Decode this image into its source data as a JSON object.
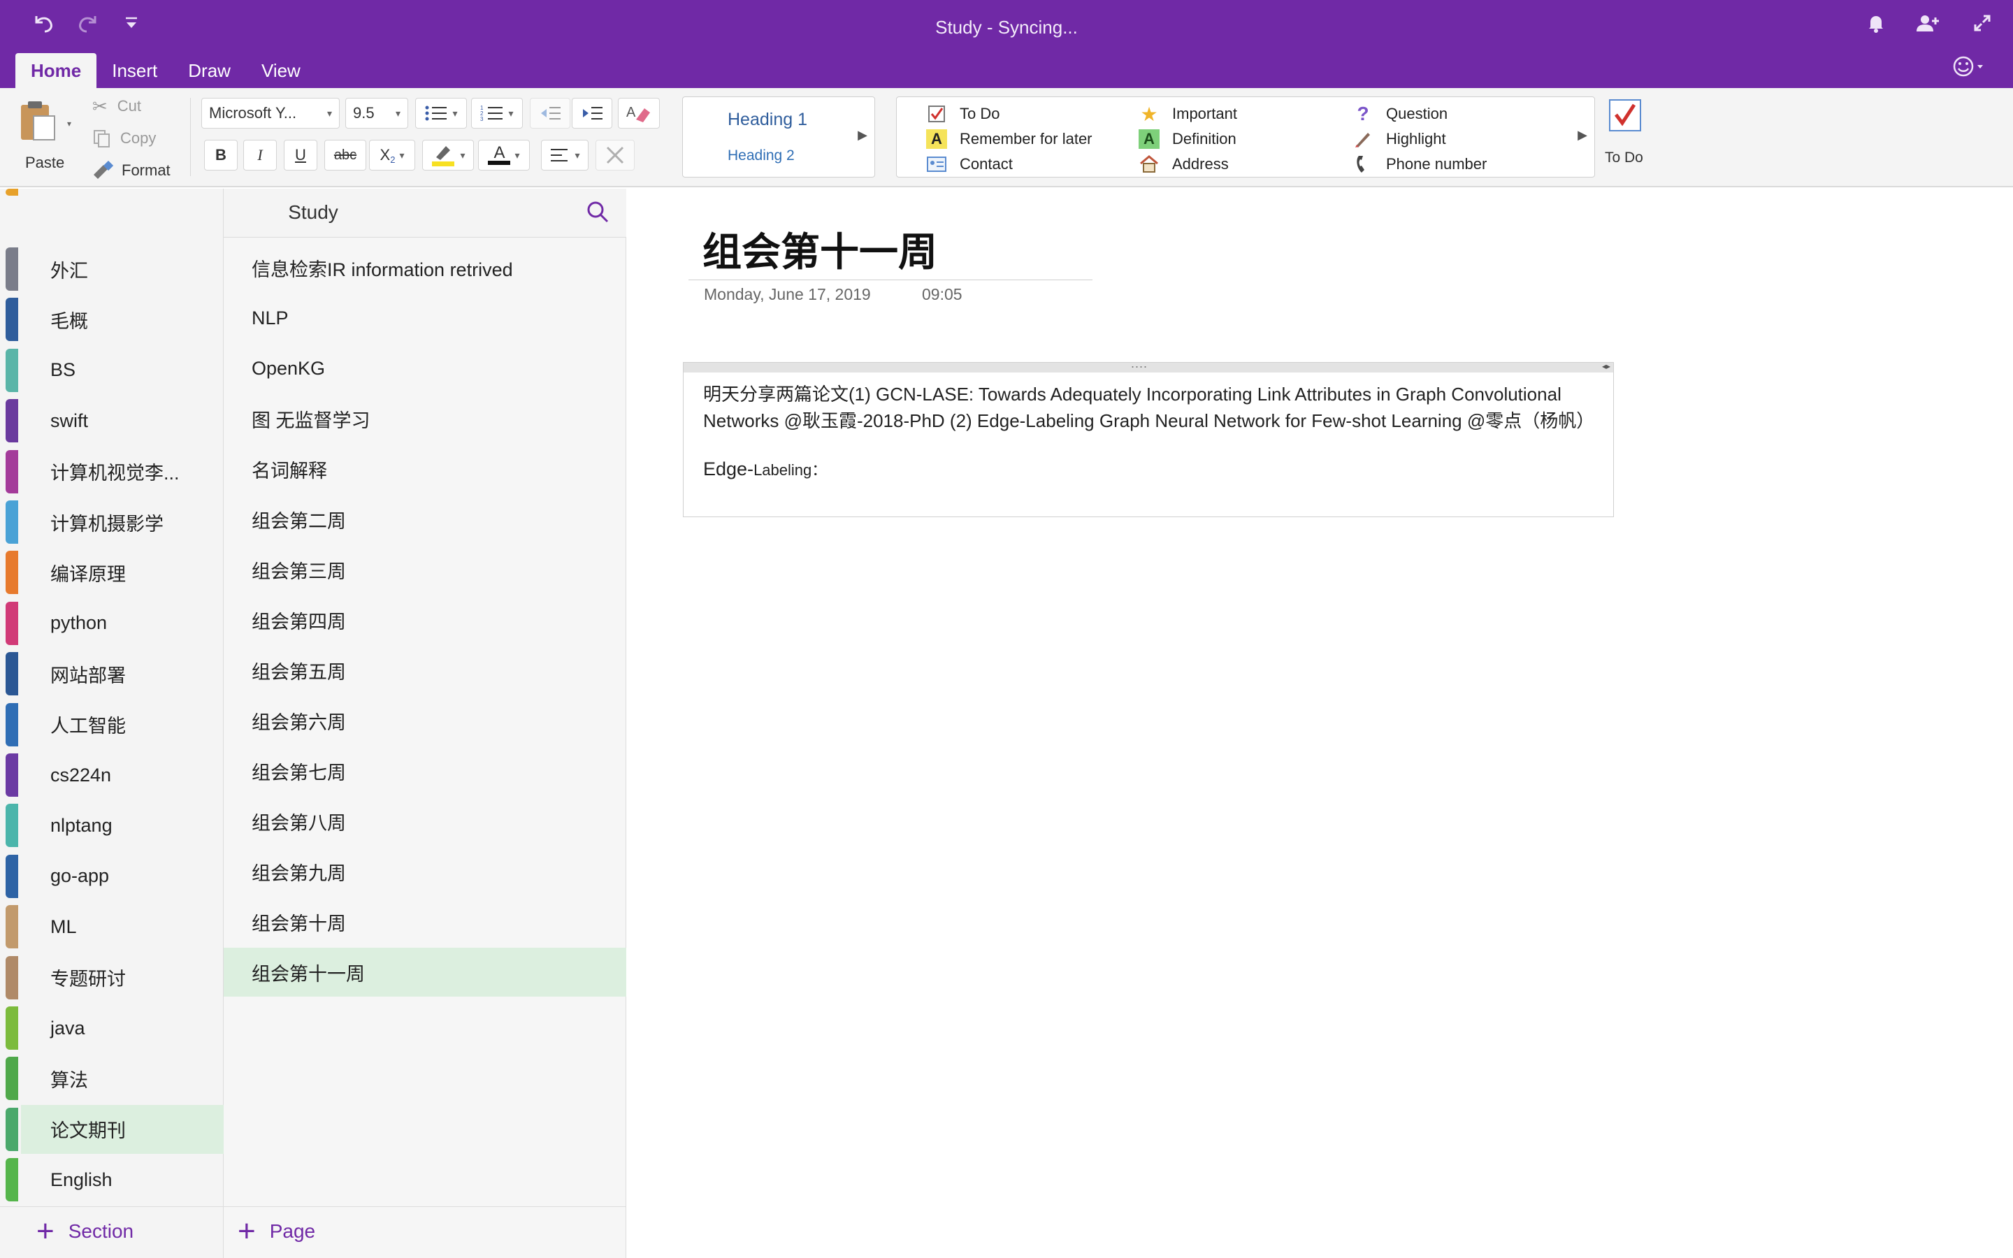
{
  "window": {
    "title": "Study - Syncing...",
    "accent": "#7029a6"
  },
  "quick_access": {
    "undo_icon": "undo-icon",
    "redo_icon": "redo-icon",
    "customize_icon": "chevron-down-icon"
  },
  "top_right": {
    "notifications_icon": "bell-icon",
    "share_icon": "add-person-icon",
    "fullscreen_icon": "expand-icon",
    "feedback_icon": "smiley-icon"
  },
  "tabs": [
    {
      "label": "Home",
      "active": true
    },
    {
      "label": "Insert",
      "active": false
    },
    {
      "label": "Draw",
      "active": false
    },
    {
      "label": "View",
      "active": false
    }
  ],
  "ribbon": {
    "clipboard": {
      "paste": "Paste",
      "cut": "Cut",
      "copy": "Copy",
      "format": "Format"
    },
    "font": {
      "family": "Microsoft Y...",
      "size": "9.5"
    },
    "format_buttons": {
      "bold": "B",
      "italic": "I",
      "underline": "U",
      "strike": "abc",
      "subscript": "X",
      "subscript_small": "2",
      "font_color_letter": "A"
    },
    "styles": {
      "heading1": "Heading 1",
      "heading2": "Heading 2"
    },
    "tags": {
      "col1": [
        "To Do",
        "Remember for later",
        "Contact"
      ],
      "col2": [
        "Important",
        "Definition",
        "Address"
      ],
      "col3": [
        "Question",
        "Highlight",
        "Phone number"
      ]
    },
    "todo_button": "To Do"
  },
  "notebook": {
    "title": "Study"
  },
  "sections": [
    {
      "label": "外汇",
      "color": "#7a7d8a"
    },
    {
      "label": "毛概",
      "color": "#2f5d9c"
    },
    {
      "label": "BS",
      "color": "#5ab5a8"
    },
    {
      "label": "swift",
      "color": "#6a3a9e"
    },
    {
      "label": "计算机视觉李...",
      "color": "#a43b9a"
    },
    {
      "label": "计算机摄影学",
      "color": "#4aa2d6"
    },
    {
      "label": "编译原理",
      "color": "#e77a2d"
    },
    {
      "label": "python",
      "color": "#d13a77"
    },
    {
      "label": "网站部署",
      "color": "#2b5794"
    },
    {
      "label": "人工智能",
      "color": "#2f6eb5"
    },
    {
      "label": "cs224n",
      "color": "#6b3aa3"
    },
    {
      "label": "nlptang",
      "color": "#4bb5ab"
    },
    {
      "label": "go-app",
      "color": "#2e63a5"
    },
    {
      "label": "ML",
      "color": "#c29a6c"
    },
    {
      "label": "专题研讨",
      "color": "#b08a68"
    },
    {
      "label": "java",
      "color": "#7cbb3c"
    },
    {
      "label": "算法",
      "color": "#4fa84a"
    },
    {
      "label": "论文期刊",
      "color": "#4aa86b",
      "active": true
    },
    {
      "label": "English",
      "color": "#55b54b"
    }
  ],
  "pages": [
    {
      "label": "信息检索IR information retrived"
    },
    {
      "label": "NLP"
    },
    {
      "label": "OpenKG"
    },
    {
      "label": "图 无监督学习"
    },
    {
      "label": "名词解释"
    },
    {
      "label": "组会第二周"
    },
    {
      "label": "组会第三周"
    },
    {
      "label": "组会第四周"
    },
    {
      "label": "组会第五周"
    },
    {
      "label": "组会第六周"
    },
    {
      "label": "组会第七周"
    },
    {
      "label": "组会第八周"
    },
    {
      "label": "组会第九周"
    },
    {
      "label": "组会第十周"
    },
    {
      "label": "组会第十一周",
      "active": true
    }
  ],
  "footer": {
    "add_section": "Section",
    "add_page": "Page"
  },
  "page": {
    "title": "组会第十一周",
    "date": "Monday, June 17, 2019",
    "time": "09:05",
    "note_text": "明天分享两篇论文(1) GCN-LASE: Towards Adequately Incorporating Link Attributes in Graph Convolutional Networks @耿玉霞-2018-PhD (2) Edge-Labeling Graph Neural Network for Few-shot Learning @零点（杨帆）",
    "note_sub_main": "Edge-",
    "note_sub_small": "Labeling："
  }
}
